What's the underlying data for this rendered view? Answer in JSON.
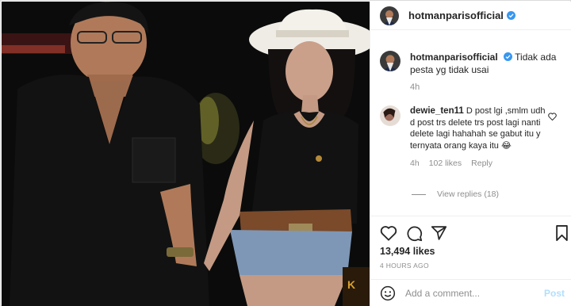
{
  "post": {
    "username": "hotmanparisofficial",
    "verified": true
  },
  "caption": {
    "username": "hotmanparisofficial",
    "text": "Tidak ada pesta yg tidak usai",
    "age": "4h"
  },
  "comment": {
    "username": "dewie_ten11",
    "text": "D post lgi ,smlm udh d post trs delete trs post lagi nanti delete lagi hahahah se gabut itu y ternyata orang kaya itu",
    "emoji": "😂",
    "age": "4h",
    "likes": "102 likes",
    "reply_label": "Reply",
    "view_replies": "View replies (18)"
  },
  "engagement": {
    "likes": "13,494 likes",
    "time": "4 HOURS AGO"
  },
  "add_comment": {
    "placeholder": "Add a comment...",
    "post_label": "Post"
  },
  "colors": {
    "verified_blue": "#3897f0",
    "post_button_disabled": "#b2dffc",
    "meta_gray": "#8e8e8e"
  },
  "icons": [
    "verified-icon",
    "heart-icon",
    "comment-icon",
    "share-icon",
    "bookmark-icon",
    "emoji-icon"
  ]
}
